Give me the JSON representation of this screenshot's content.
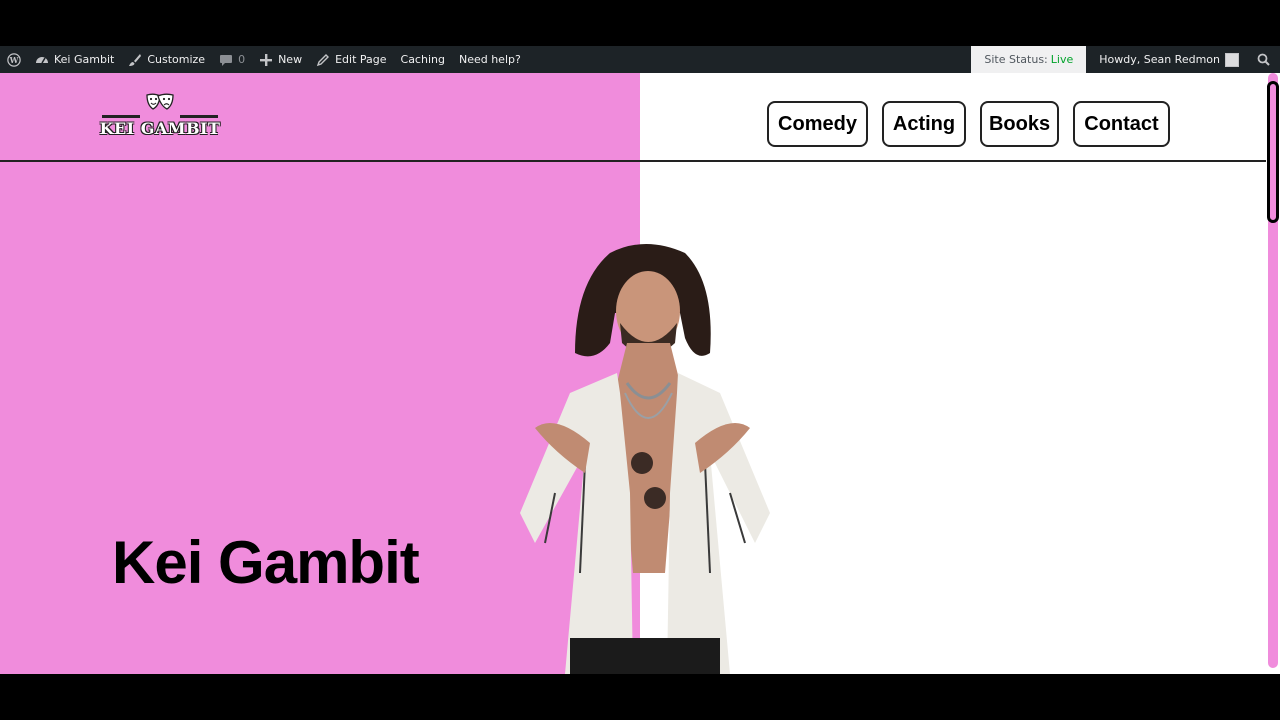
{
  "adminbar": {
    "site_name": "Kei Gambit",
    "customize": "Customize",
    "comments_count": "0",
    "new": "New",
    "edit_page": "Edit Page",
    "caching": "Caching",
    "need_help": "Need help?",
    "site_status_label": "Site Status:",
    "site_status_value": "Live",
    "howdy": "Howdy, Sean Redmon"
  },
  "header": {
    "logo_text": "KEI GAMBIT",
    "nav": [
      "Comedy",
      "Acting",
      "Books",
      "Contact"
    ]
  },
  "hero": {
    "title": "Kei Gambit"
  },
  "colors": {
    "accent_pink": "#f08cdc",
    "admin_bar": "#1d2327",
    "status_live": "#00a32a"
  }
}
